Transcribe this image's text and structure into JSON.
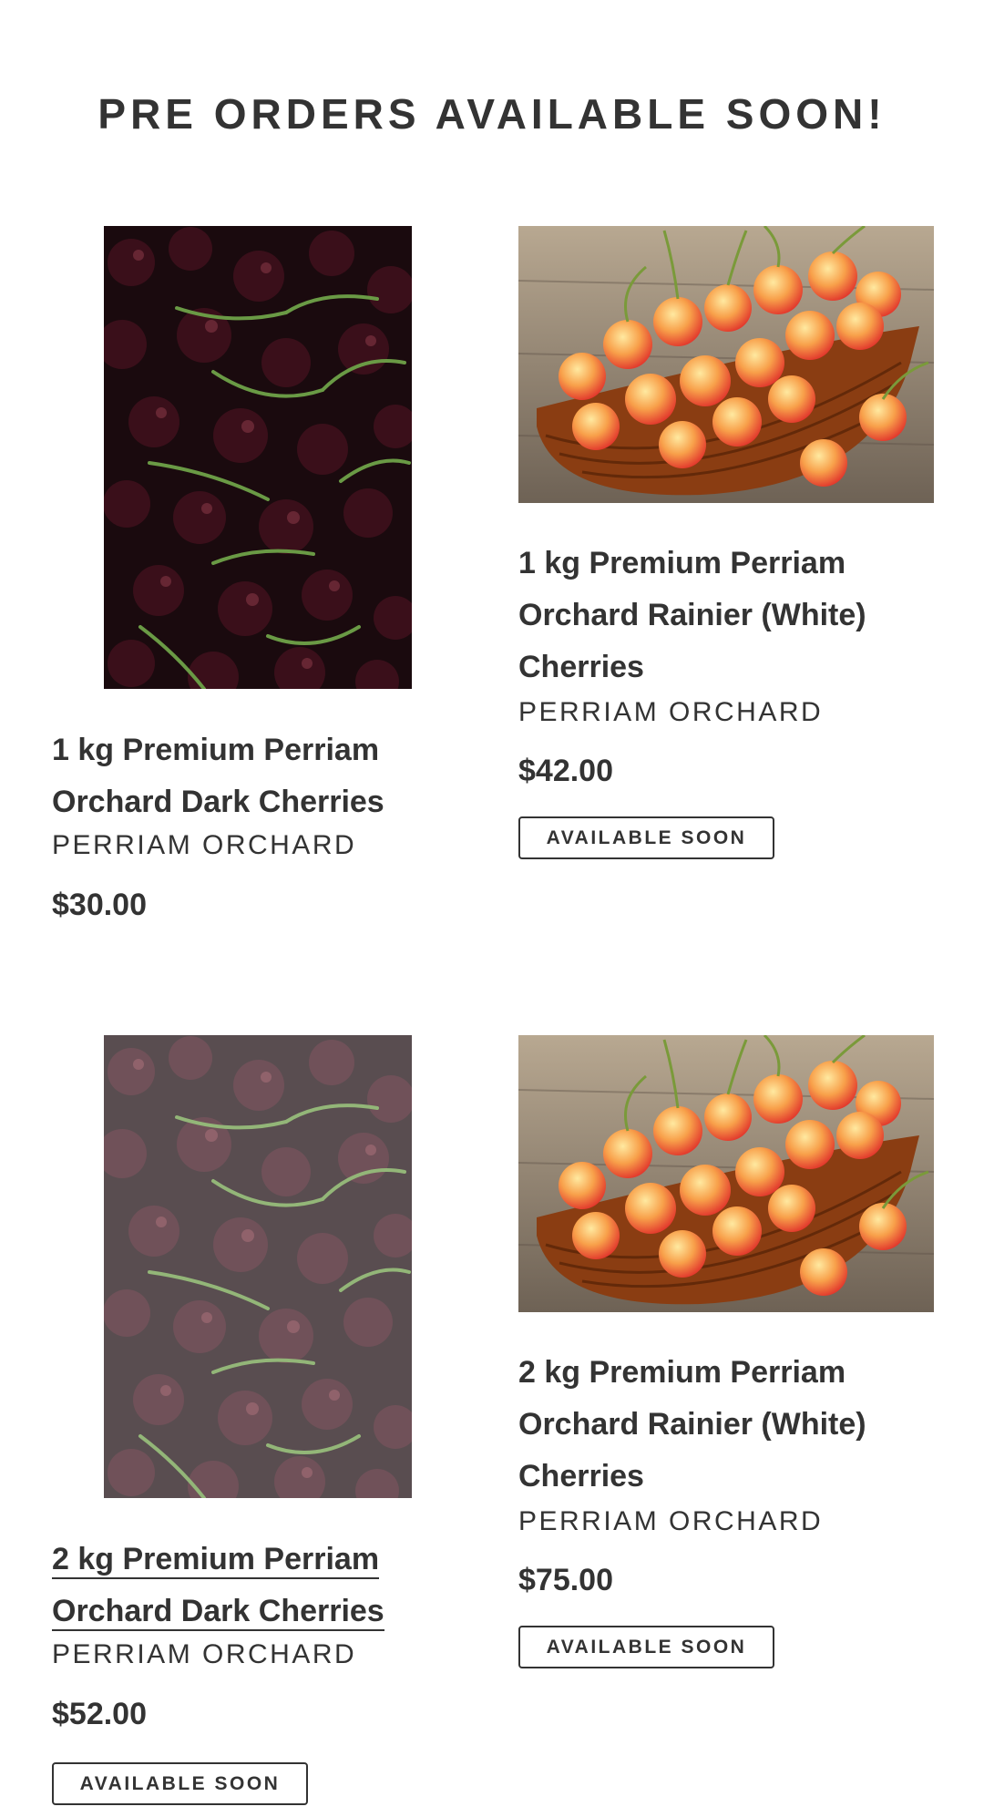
{
  "section": {
    "title": "PRE ORDERS AVAILABLE SOON!"
  },
  "products": [
    {
      "title": "1 kg Premium Perriam Orchard Dark Cherries",
      "title_lines": [
        "1 kg Premium Perriam",
        "Orchard Dark Cherries"
      ],
      "vendor": "PERRIAM ORCHARD",
      "price": "$30.00",
      "badge": ""
    },
    {
      "title": "1 kg Premium Perriam Orchard Rainier (White) Cherries",
      "title_lines": [
        "1 kg Premium Perriam",
        "Orchard Rainier (White)",
        "Cherries"
      ],
      "vendor": "PERRIAM ORCHARD",
      "price": "$42.00",
      "badge": "AVAILABLE SOON"
    },
    {
      "title": "2 kg Premium Perriam Orchard Dark Cherries",
      "title_lines": [
        "2 kg Premium Perriam",
        "Orchard Dark Cherries"
      ],
      "vendor": "PERRIAM ORCHARD",
      "price": "$52.00",
      "badge": "AVAILABLE SOON"
    },
    {
      "title": "2 kg Premium Perriam Orchard Rainier (White) Cherries",
      "title_lines": [
        "2 kg Premium Perriam",
        "Orchard Rainier (White)",
        "Cherries"
      ],
      "vendor": "PERRIAM ORCHARD",
      "price": "$75.00",
      "badge": "AVAILABLE SOON"
    }
  ],
  "colors": {
    "text": "#333333",
    "background": "#ffffff",
    "dark_cherry": "#2a0d14",
    "rainier_cherry": "#f0513a"
  }
}
